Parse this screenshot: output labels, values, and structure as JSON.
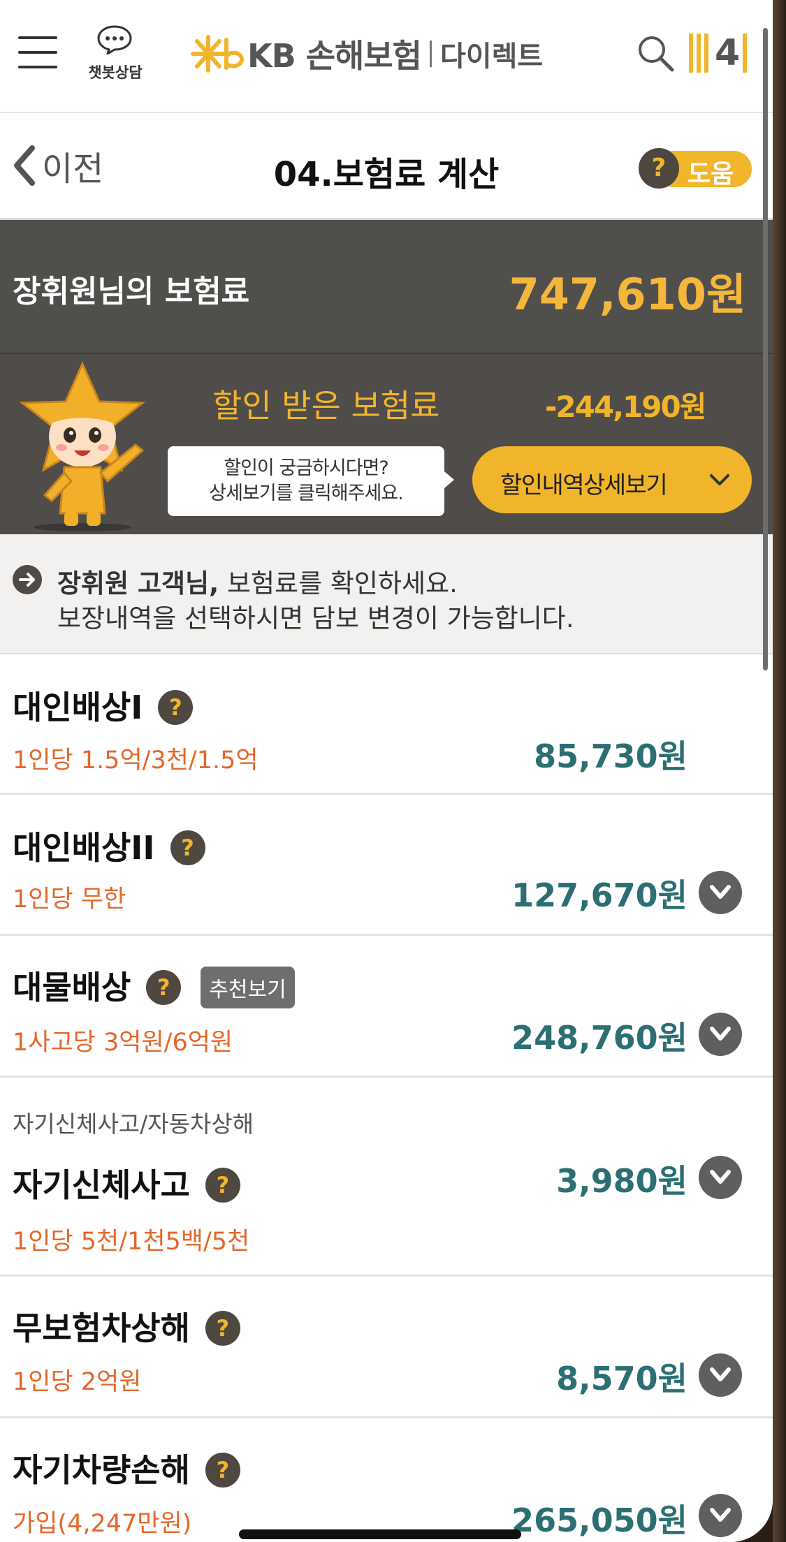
{
  "header": {
    "chatbot_label": "챗봇상담",
    "logo_kb": "KB 손해보험",
    "logo_direct": "다이렉트",
    "menu_badge": "4"
  },
  "titlebar": {
    "back_label": "이전",
    "title": "04.보험료 계산",
    "help_icon": "?",
    "help_label": "도움"
  },
  "premium": {
    "label": "장휘원님의 보험료",
    "amount": "747,610원"
  },
  "discount": {
    "label": "할인 받은 보험료",
    "amount": "-244,190원",
    "tooltip_line1": "할인이 궁금하시다면?",
    "tooltip_line2": "상세보기를 클릭해주세요.",
    "detail_button": "할인내역상세보기"
  },
  "note": {
    "customer": "장휘원 고객님,",
    "line1_rest": " 보험료를 확인하세요.",
    "line2": "보장내역을 선택하시면 담보 변경이 가능합니다."
  },
  "items": [
    {
      "title": "대인배상I",
      "detail": "1인당 1.5억/3천/1.5억",
      "price": "85,730원"
    },
    {
      "title": "대인배상II",
      "detail": "1인당 무한",
      "price": "127,670원"
    },
    {
      "title": "대물배상",
      "recommend": "추천보기",
      "detail": "1사고당 3억원/6억원",
      "price": "248,760원"
    },
    {
      "category": "자기신체사고/자동차상해",
      "title": "자기신체사고",
      "detail": "1인당 5천/1천5백/5천",
      "price": "3,980원"
    },
    {
      "title": "무보험차상해",
      "detail": "1인당 2억원",
      "price": "8,570원"
    },
    {
      "title": "자기차량손해",
      "detail": "가입(4,247만원)",
      "price": "265,050원"
    }
  ],
  "help_mark": "?",
  "colors": {
    "accent": "#f1b52b",
    "banner": "#514f4c",
    "price": "#2c6f73",
    "detail": "#e4672a"
  }
}
